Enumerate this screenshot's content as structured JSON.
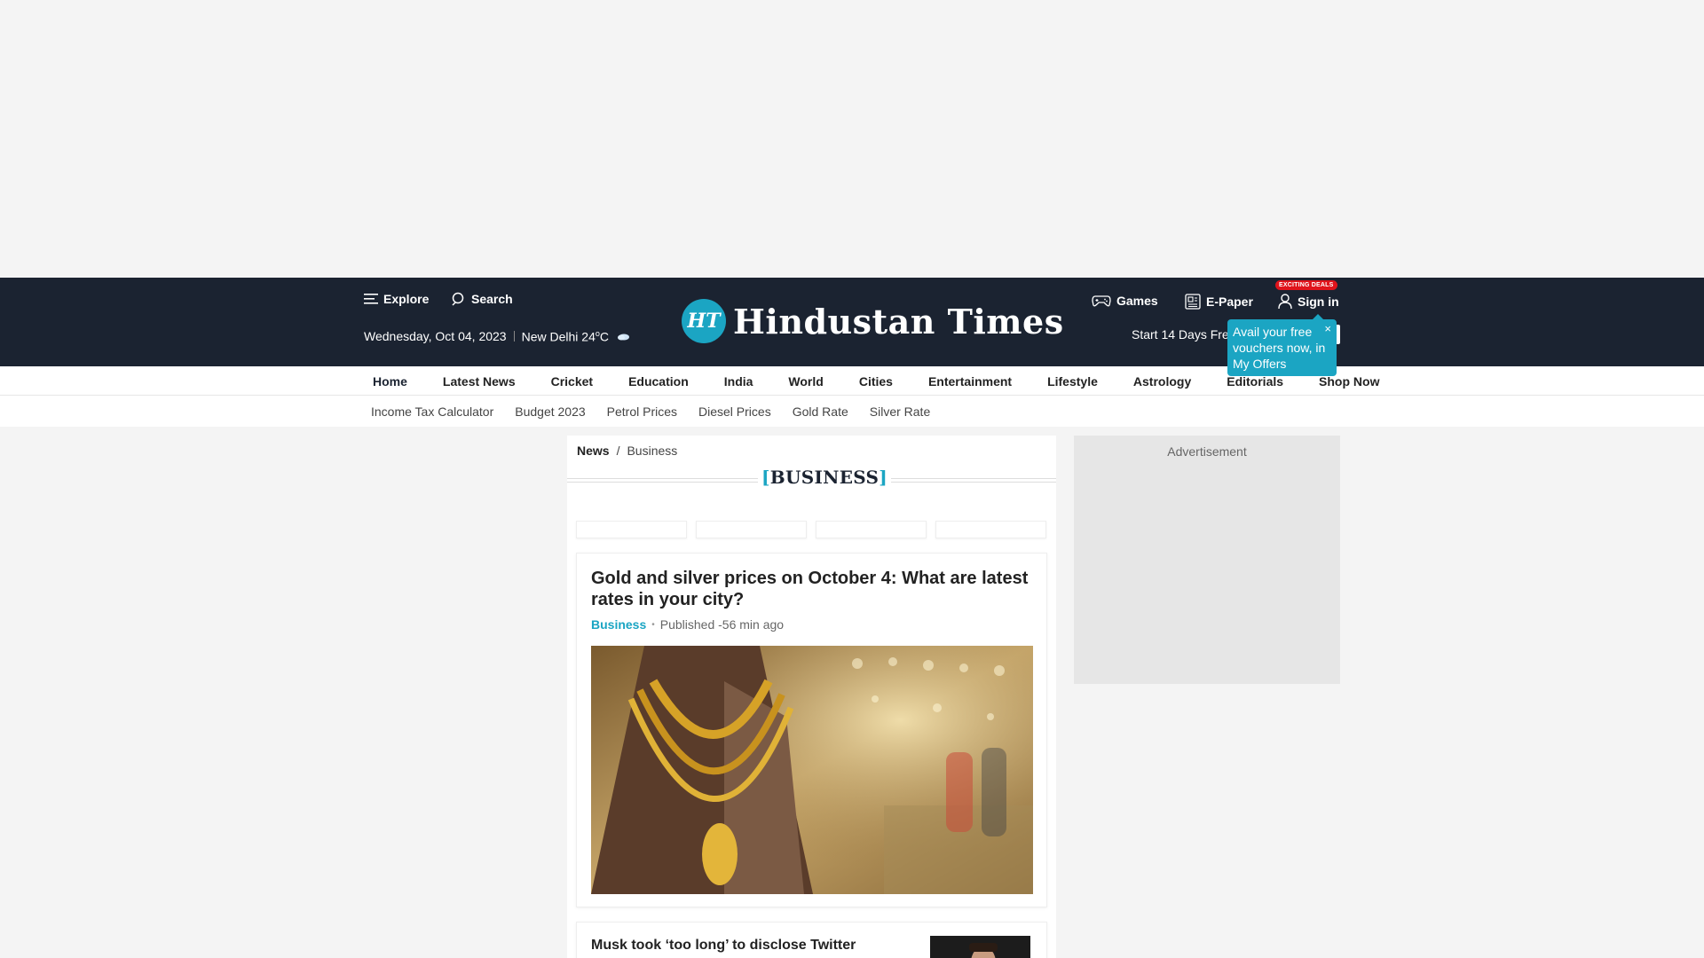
{
  "header": {
    "explore_label": "Explore",
    "search_label": "Search",
    "date": "Wednesday, Oct 04, 2023",
    "city_weather": "New Delhi 24",
    "temp_unit_sup": "o",
    "temp_unit": "C",
    "logo_mark": "HT",
    "logo_text": "Hindustan Times",
    "games_label": "Games",
    "epaper_label": "E-Paper",
    "signin_label": "Sign in",
    "deals_badge": "EXCITING DEALS",
    "trial_text": "Start 14 Days Fre",
    "tooltip_text": "Avail your free vouchers now, in My Offers",
    "tooltip_close": "×"
  },
  "nav_primary": [
    "Home",
    "Latest News",
    "Cricket",
    "Education",
    "India",
    "World",
    "Cities",
    "Entertainment",
    "Lifestyle",
    "Astrology",
    "Editorials",
    "Shop Now"
  ],
  "nav_secondary": [
    "Income Tax Calculator",
    "Budget 2023",
    "Petrol Prices",
    "Diesel Prices",
    "Gold Rate",
    "Silver Rate"
  ],
  "breadcrumb": {
    "home": "News",
    "separator": "/",
    "current": "Business"
  },
  "section": {
    "open_bracket": "[",
    "title": "BUSINESS",
    "close_bracket": "]"
  },
  "articles": [
    {
      "headline": "Gold and silver prices on October 4: What are latest rates in your city?",
      "category": "Business",
      "published": "Published -56 min ago"
    },
    {
      "headline": "Musk took ‘too long’ to disclose Twitter"
    }
  ],
  "sidebar": {
    "ad_label": "Advertisement"
  },
  "colors": {
    "header_bg": "#1b2331",
    "accent": "#1ba5c3",
    "badge_red": "#e0131b"
  }
}
